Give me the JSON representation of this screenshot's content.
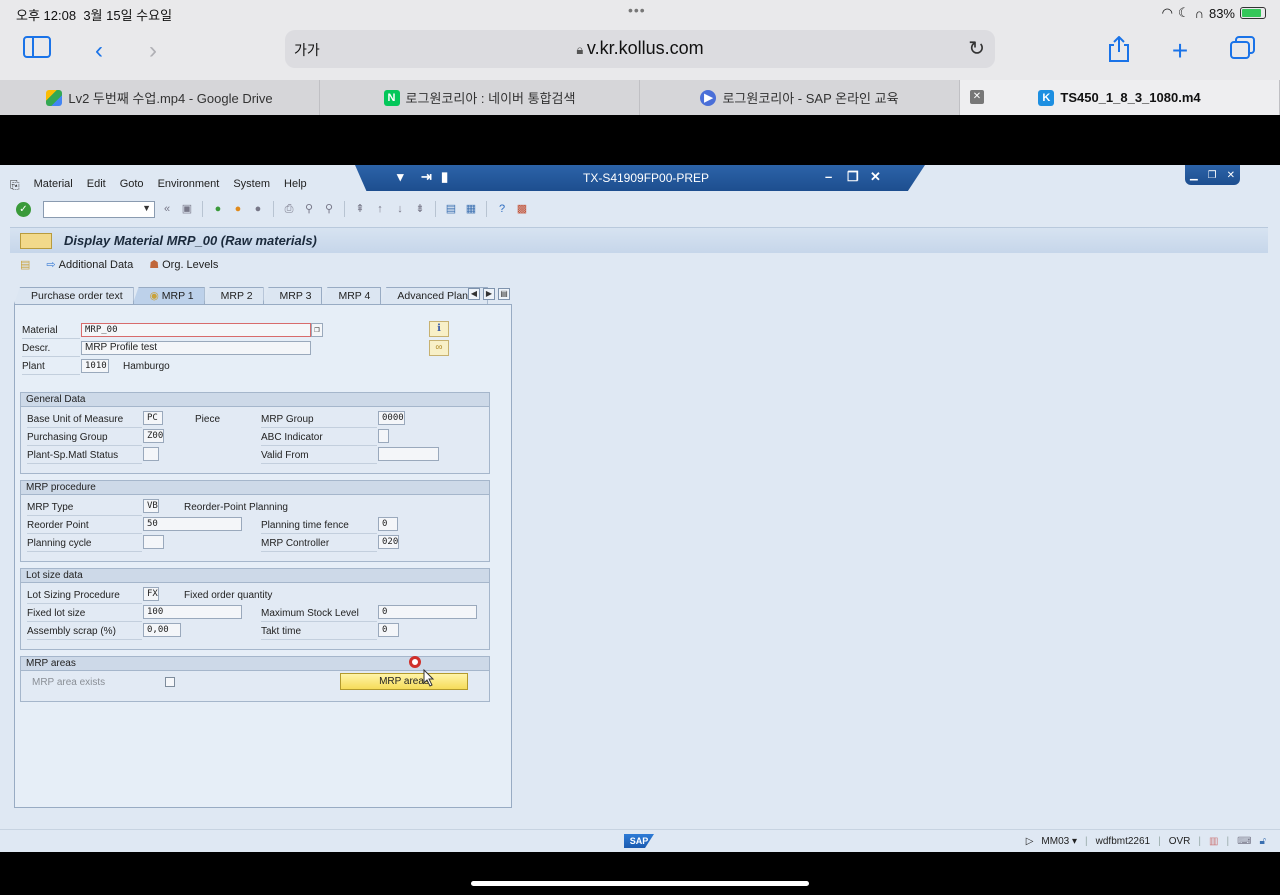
{
  "ipad": {
    "time": "오후 12:08",
    "date": "3월 15일 수요일",
    "battery": "83%"
  },
  "safari": {
    "text_size": "가가",
    "url": "v.kr.kollus.com",
    "tabs": [
      {
        "label": "Lv2 두번째 수업.mp4 - Google Drive"
      },
      {
        "label": "로그원코리아 : 네이버 통합검색"
      },
      {
        "label": "로그원코리아 - SAP 온라인 교육"
      },
      {
        "label": "TS450_1_8_3_1080.m4"
      }
    ]
  },
  "sap": {
    "window_title": "TX-S41909FP00-PREP",
    "menu": [
      "Material",
      "Edit",
      "Goto",
      "Environment",
      "System",
      "Help"
    ],
    "screen_title": "Display Material MRP_00 (Raw materials)",
    "app_toolbar": {
      "additional_data": "Additional Data",
      "org_levels": "Org. Levels"
    },
    "tabs": [
      "Purchase order text",
      "MRP 1",
      "MRP 2",
      "MRP 3",
      "MRP 4",
      "Advanced Plan..."
    ],
    "active_tab": "MRP 1",
    "header": {
      "material_label": "Material",
      "material": "MRP_00",
      "descr_label": "Descr.",
      "descr": "MRP Profile test",
      "plant_label": "Plant",
      "plant": "1010",
      "plant_name": "Hamburgo"
    },
    "general": {
      "title": "General Data",
      "base_uom_label": "Base Unit of Measure",
      "base_uom": "PC",
      "base_uom_text": "Piece",
      "mrp_group_label": "MRP Group",
      "mrp_group": "0000",
      "purch_group_label": "Purchasing Group",
      "purch_group": "Z00",
      "abc_label": "ABC Indicator",
      "abc": "",
      "status_label": "Plant-Sp.Matl Status",
      "status": "",
      "valid_from_label": "Valid From",
      "valid_from": ""
    },
    "procedure": {
      "title": "MRP procedure",
      "mrp_type_label": "MRP Type",
      "mrp_type": "VB",
      "mrp_type_text": "Reorder-Point Planning",
      "reorder_label": "Reorder Point",
      "reorder": "50",
      "ptf_label": "Planning time fence",
      "ptf": "0",
      "cycle_label": "Planning cycle",
      "cycle": "",
      "controller_label": "MRP Controller",
      "controller": "020"
    },
    "lotsize": {
      "title": "Lot size data",
      "proc_label": "Lot Sizing Procedure",
      "proc": "FX",
      "proc_text": "Fixed order quantity",
      "fixed_label": "Fixed lot size",
      "fixed": "100",
      "max_label": "Maximum Stock Level",
      "max": "0",
      "scrap_label": "Assembly scrap (%)",
      "scrap": "0,00",
      "takt_label": "Takt time",
      "takt": "0"
    },
    "areas": {
      "title": "MRP areas",
      "exists_label": "MRP area exists",
      "button": "MRP areas"
    },
    "status": {
      "logo": "SAP",
      "transaction": "MM03",
      "server": "wdfbmt2261",
      "mode": "OVR"
    }
  }
}
